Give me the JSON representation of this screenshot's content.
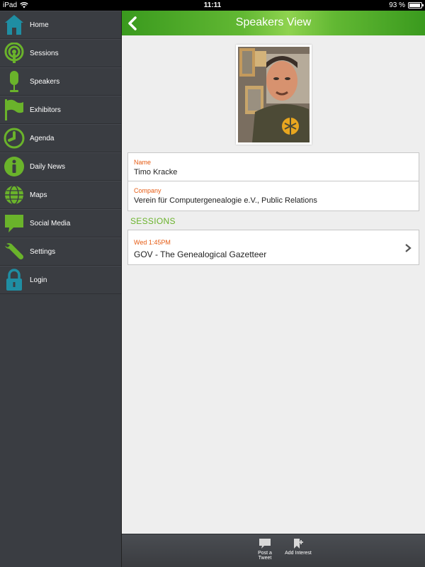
{
  "status": {
    "carrier": "iPad",
    "time": "11:11",
    "battery": "93 %",
    "battery_level": 0.93
  },
  "sidebar": {
    "items": [
      {
        "label": "Home",
        "icon": "home-icon"
      },
      {
        "label": "Sessions",
        "icon": "podcast-icon"
      },
      {
        "label": "Speakers",
        "icon": "microphone-icon"
      },
      {
        "label": "Exhibitors",
        "icon": "flag-icon"
      },
      {
        "label": "Agenda",
        "icon": "clock-icon"
      },
      {
        "label": "Daily News",
        "icon": "info-icon"
      },
      {
        "label": "Maps",
        "icon": "globe-icon"
      },
      {
        "label": "Social Media",
        "icon": "chat-icon"
      },
      {
        "label": "Settings",
        "icon": "wrench-icon"
      },
      {
        "label": "Login",
        "icon": "lock-icon"
      }
    ]
  },
  "header": {
    "title": "Speakers View"
  },
  "speaker": {
    "name_label": "Name",
    "name": "Timo Kracke",
    "company_label": "Company",
    "company": "Verein für Computergenealogie e.V., Public Relations"
  },
  "sessions": {
    "title": "SESSIONS",
    "items": [
      {
        "when": "Wed 1:45PM",
        "name": "GOV - The Genealogical Gazetteer"
      }
    ]
  },
  "toolbar": {
    "post_tweet": "Post a Tweet",
    "add_interest": "Add Interest"
  },
  "colors": {
    "accent_green": "#6ab32b",
    "label_orange": "#e65c14",
    "sidebar_bg": "#3a3d42",
    "home_icon": "#1f8ea3"
  }
}
